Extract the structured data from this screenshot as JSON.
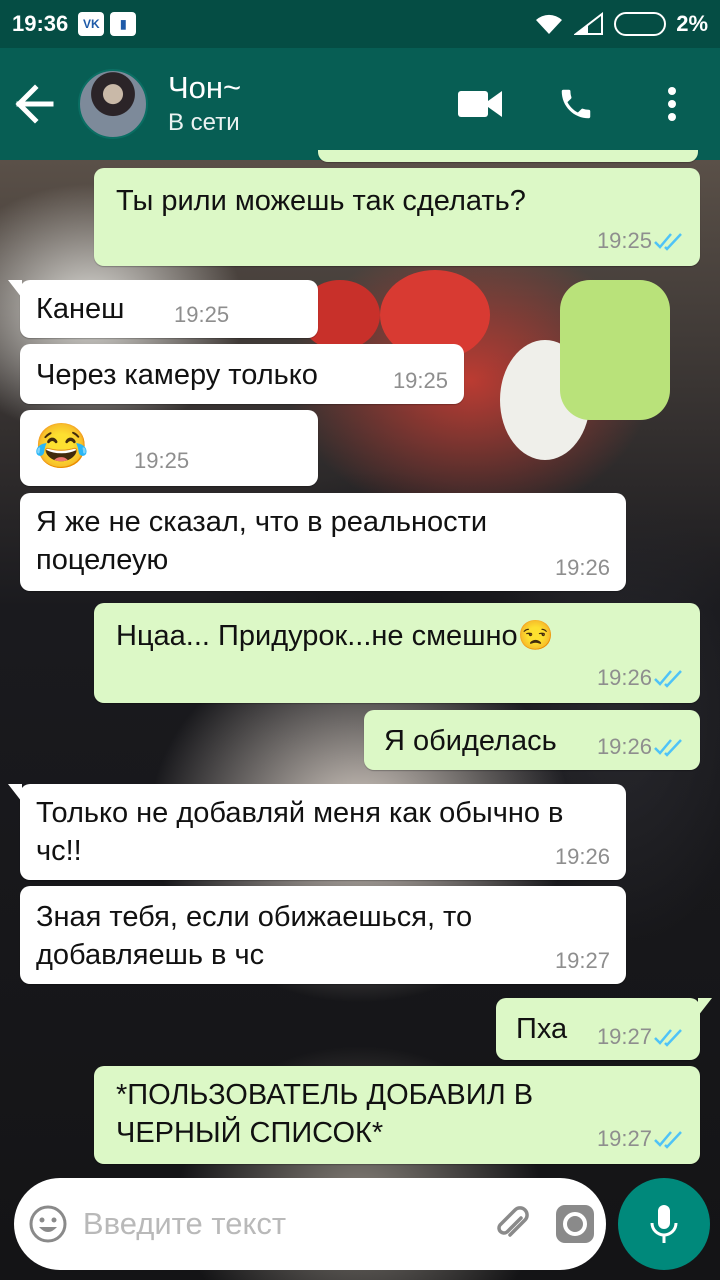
{
  "status_bar": {
    "time": "19:36",
    "battery": "2%",
    "vk_label": "VK"
  },
  "header": {
    "contact_name": "Чон~",
    "contact_status": "В сети"
  },
  "messages": [
    {
      "dir": "out",
      "text": "Ты рили можешь так сделать?",
      "time": "19:25",
      "read": true
    },
    {
      "dir": "in",
      "text": "Канеш",
      "time": "19:25"
    },
    {
      "dir": "in",
      "text": "Через камеру только",
      "time": "19:25"
    },
    {
      "dir": "in",
      "text": "😂",
      "time": "19:25"
    },
    {
      "dir": "in",
      "text": "Я же не сказал, что в реальности поцелеую",
      "time": "19:26"
    },
    {
      "dir": "out",
      "text": "Нцаа... Придурок...не смешно😒",
      "time": "19:26",
      "read": true
    },
    {
      "dir": "out",
      "text": "Я обиделась",
      "time": "19:26",
      "read": true
    },
    {
      "dir": "in",
      "text": "Только не добавляй меня как обычно в чс!!",
      "time": "19:26"
    },
    {
      "dir": "in",
      "text": "Зная тебя, если обижаешься, то добавляешь в чс",
      "time": "19:27"
    },
    {
      "dir": "out",
      "text": "Пха",
      "time": "19:27",
      "read": true
    },
    {
      "dir": "out",
      "text": "*ПОЛЬЗОВАТЕЛЬ ДОБАВИЛ В ЧЕРНЫЙ СПИСОК*",
      "time": "19:27",
      "read": true
    }
  ],
  "input": {
    "placeholder": "Введите текст"
  },
  "icons": {
    "back": "back-arrow-icon",
    "video": "video-call-icon",
    "call": "phone-icon",
    "menu": "more-vert-icon",
    "emoji": "emoji-icon",
    "attach": "paperclip-icon",
    "camera": "camera-icon",
    "mic": "microphone-icon"
  },
  "colors": {
    "header": "#075e54",
    "status_bar": "#054d44",
    "outgoing": "#dcf8c6",
    "incoming": "#ffffff",
    "read_ticks": "#4fc3f7",
    "mic": "#00897b"
  }
}
